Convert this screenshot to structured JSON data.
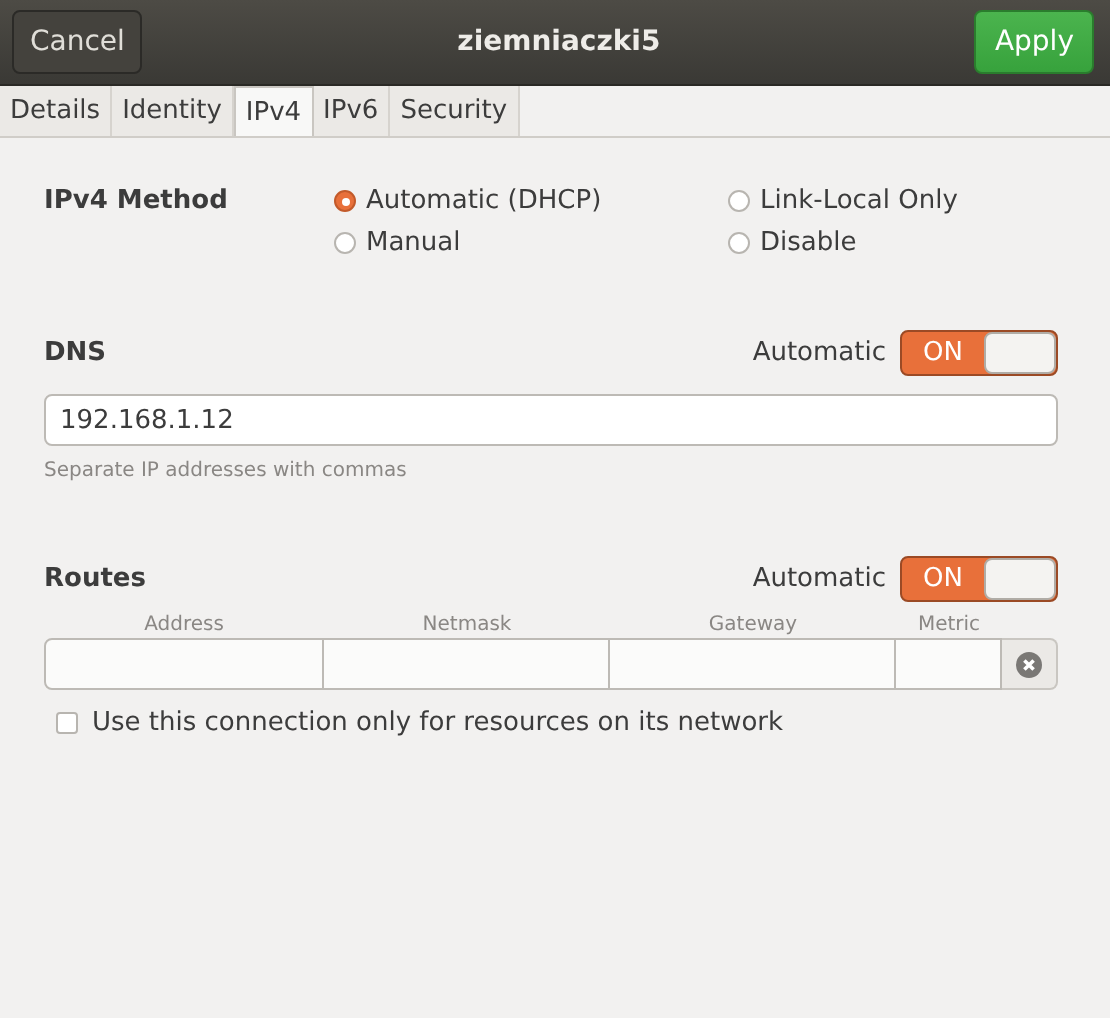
{
  "header": {
    "cancel": "Cancel",
    "title": "ziemniaczki5",
    "apply": "Apply"
  },
  "tabs": [
    {
      "label": "Details",
      "selected": false
    },
    {
      "label": "Identity",
      "selected": false
    },
    {
      "label": "IPv4",
      "selected": true
    },
    {
      "label": "IPv6",
      "selected": false
    },
    {
      "label": "Security",
      "selected": false
    }
  ],
  "method": {
    "label": "IPv4 Method",
    "options": [
      {
        "label": "Automatic (DHCP)",
        "selected": true
      },
      {
        "label": "Link-Local Only",
        "selected": false
      },
      {
        "label": "Manual",
        "selected": false
      },
      {
        "label": "Disable",
        "selected": false
      }
    ]
  },
  "dns": {
    "label": "DNS",
    "automatic_label": "Automatic",
    "switch_text": "ON",
    "on": true,
    "value": "192.168.1.12",
    "hint": "Separate IP addresses with commas"
  },
  "routes": {
    "label": "Routes",
    "automatic_label": "Automatic",
    "switch_text": "ON",
    "on": true,
    "columns": [
      "Address",
      "Netmask",
      "Gateway",
      "Metric"
    ],
    "only_local": {
      "label": "Use this connection only for resources on its network",
      "checked": false
    }
  }
}
